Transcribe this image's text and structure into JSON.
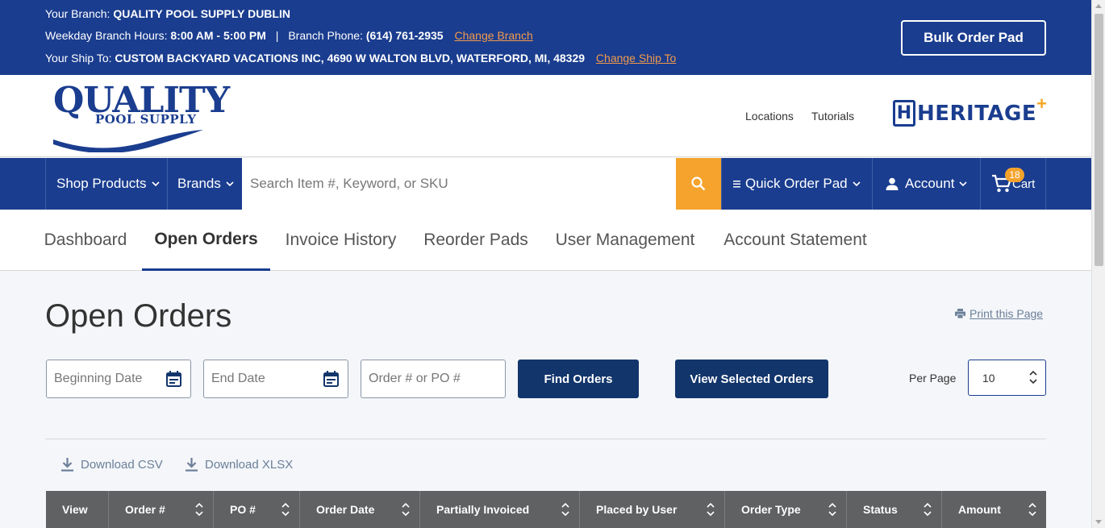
{
  "branch_bar": {
    "branch_label": "Your Branch:",
    "branch_name": "QUALITY POOL SUPPLY DUBLIN",
    "hours_label": "Weekday Branch Hours:",
    "hours_value": "8:00 AM - 5:00 PM",
    "divider": "|",
    "phone_label": "Branch Phone:",
    "phone_value": "(614) 761-2935",
    "change_branch": "Change Branch",
    "ship_to_label": "Your Ship To:",
    "ship_to_value": "CUSTOM BACKYARD VACATIONS INC, 4690 W WALTON BLVD, WATERFORD, MI, 48329",
    "change_ship_to": "Change Ship To",
    "bulk_order_pad": "Bulk Order Pad"
  },
  "header": {
    "logo_line1": "QUALITY",
    "logo_line2": "POOL SUPPLY",
    "locations": "Locations",
    "tutorials": "Tutorials",
    "partner_logo_letter": "H",
    "partner_logo_text": "HERITAGE",
    "partner_logo_plus": "+"
  },
  "nav": {
    "shop_products": "Shop Products",
    "brands": "Brands",
    "search_placeholder": "Search Item #, Keyword, or SKU",
    "quick_order_pad": "Quick Order Pad",
    "account": "Account",
    "cart": "Cart",
    "cart_count": "18",
    "caret": "⌄"
  },
  "account_tabs": [
    {
      "label": "Dashboard",
      "active": false
    },
    {
      "label": "Open Orders",
      "active": true
    },
    {
      "label": "Invoice History",
      "active": false
    },
    {
      "label": "Reorder Pads",
      "active": false
    },
    {
      "label": "User Management",
      "active": false
    },
    {
      "label": "Account Statement",
      "active": false
    }
  ],
  "page": {
    "title": "Open Orders",
    "print": "Print this Page"
  },
  "filters": {
    "beginning_date_placeholder": "Beginning Date",
    "end_date_placeholder": "End Date",
    "order_placeholder": "Order # or PO #",
    "find_orders": "Find Orders",
    "view_selected_orders": "View Selected Orders",
    "per_page_label": "Per Page",
    "per_page_value": "10"
  },
  "downloads": {
    "csv": "Download CSV",
    "xlsx": "Download XLSX"
  },
  "table": {
    "columns": [
      "View",
      "Order #",
      "PO #",
      "Order Date",
      "Partially Invoiced",
      "Placed by User",
      "Order Type",
      "Status",
      "Amount"
    ]
  },
  "colors": {
    "brand_blue": "#1a3d8f",
    "accent_orange": "#f5a32c",
    "button_navy": "#12356b",
    "table_header": "#5f6163"
  }
}
